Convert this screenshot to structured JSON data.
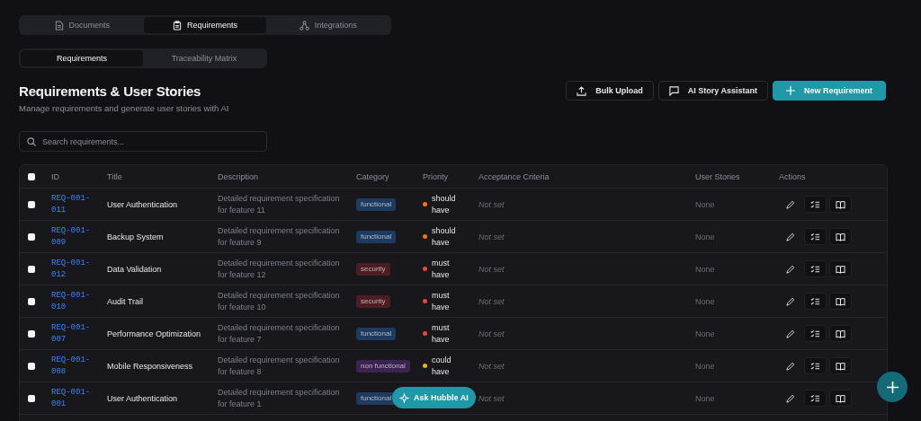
{
  "top_tabs": [
    {
      "label": "Documents",
      "selected": false
    },
    {
      "label": "Requirements",
      "selected": true
    },
    {
      "label": "Integrations",
      "selected": false
    }
  ],
  "sub_tabs": [
    {
      "label": "Requirements",
      "selected": true
    },
    {
      "label": "Traceability Matrix",
      "selected": false
    }
  ],
  "heading": "Requirements & User Stories",
  "subtitle": "Manage requirements and generate user stories with AI",
  "actions": [
    {
      "label": "Bulk Upload",
      "kind": "upload"
    },
    {
      "label": "AI Story Assistant",
      "kind": "chat"
    },
    {
      "label": "New Requirement",
      "kind": "primary"
    }
  ],
  "search": {
    "placeholder": "Search requirements..."
  },
  "table": {
    "select_all_checked": false,
    "columns": [
      "ID",
      "Title",
      "Description",
      "Category",
      "Priority",
      "Acceptance Criteria",
      "User Stories",
      "Actions"
    ],
    "rows": [
      {
        "id": "REQ-001-011",
        "title": "User Authentication",
        "description": "Detailed requirement specification for feature 11",
        "category": {
          "label": "functional",
          "color": "#1e3a5f"
        },
        "priority": {
          "label": "should have",
          "color": "#f97316"
        },
        "criteria": "Not set",
        "stories": "None",
        "checked": false
      },
      {
        "id": "REQ-001-009",
        "title": "Backup System",
        "description": "Detailed requirement specification for feature 9",
        "category": {
          "label": "functional",
          "color": "#1e3a5f"
        },
        "priority": {
          "label": "should have",
          "color": "#f97316"
        },
        "criteria": "Not set",
        "stories": "None",
        "checked": false
      },
      {
        "id": "REQ-001-012",
        "title": "Data Validation",
        "description": "Detailed requirement specification for feature 12",
        "category": {
          "label": "security",
          "color": "#4c1d22"
        },
        "priority": {
          "label": "must have",
          "color": "#ef4444"
        },
        "criteria": "Not set",
        "stories": "None",
        "checked": false
      },
      {
        "id": "REQ-001-010",
        "title": "Audit Trail",
        "description": "Detailed requirement specification for feature 10",
        "category": {
          "label": "security",
          "color": "#4c1d22"
        },
        "priority": {
          "label": "must have",
          "color": "#ef4444"
        },
        "criteria": "Not set",
        "stories": "None",
        "checked": false
      },
      {
        "id": "REQ-001-007",
        "title": "Performance Optimization",
        "description": "Detailed requirement specification for feature 7",
        "category": {
          "label": "functional",
          "color": "#1e3a5f"
        },
        "priority": {
          "label": "must have",
          "color": "#ef4444"
        },
        "criteria": "Not set",
        "stories": "None",
        "checked": false
      },
      {
        "id": "REQ-001-008",
        "title": "Mobile Responsiveness",
        "description": "Detailed requirement specification for feature 8",
        "category": {
          "label": "non functional",
          "color": "#3b2352"
        },
        "priority": {
          "label": "could have",
          "color": "#eab308"
        },
        "criteria": "Not set",
        "stories": "None",
        "checked": false
      },
      {
        "id": "REQ-001-001",
        "title": "User Authentication",
        "description": "Detailed requirement specification for feature 1",
        "category": {
          "label": "functional",
          "color": "#1e3a5f"
        },
        "criteria": "Not set",
        "stories": "None",
        "checked": false
      }
    ]
  },
  "ask_button": "Ask Hubble AI"
}
